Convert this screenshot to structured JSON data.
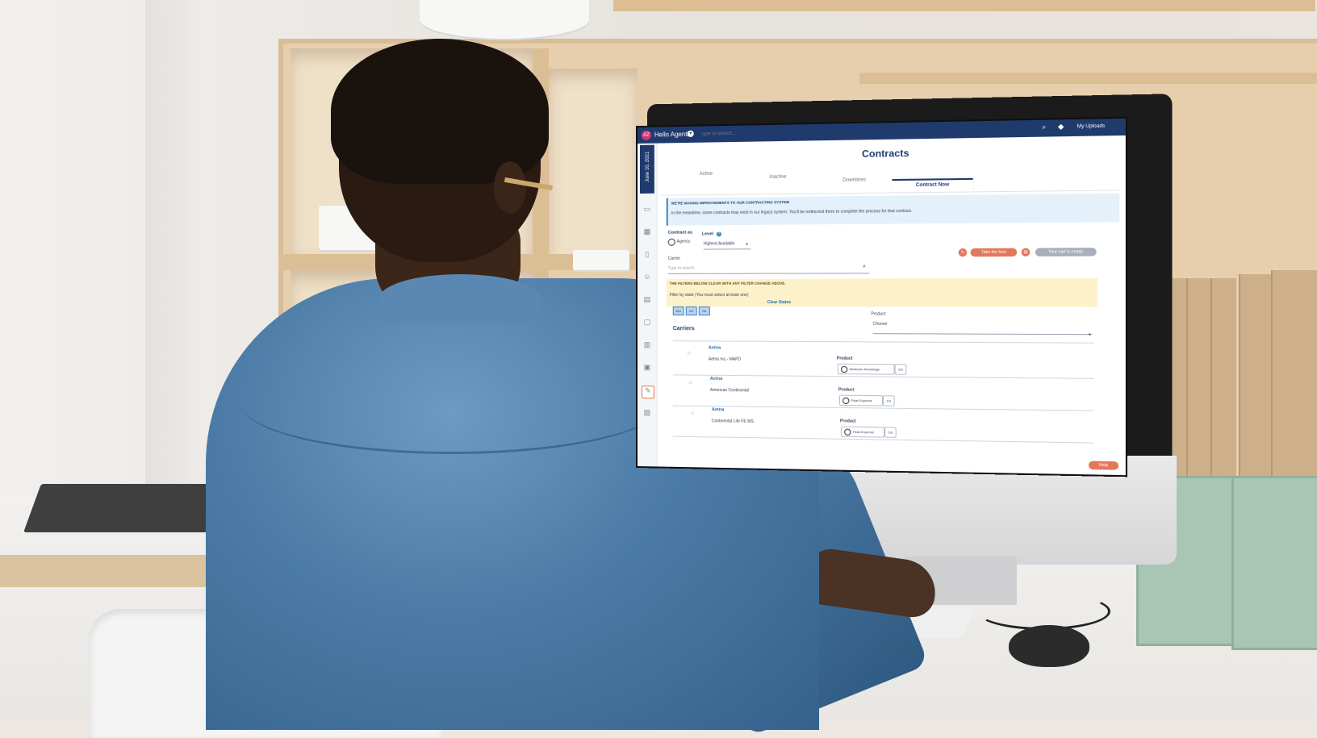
{
  "header": {
    "avatar_initials": "AZ",
    "greeting": "Hello AgentZ",
    "search_placeholder": "Type to search...",
    "uploads_label": "My Uploads"
  },
  "sidebar": {
    "date": "June 10, 2021",
    "icons": [
      "id-card-icon",
      "grid-icon",
      "document-icon",
      "people-icon",
      "inbox-icon",
      "file-icon",
      "chart-icon",
      "building-icon",
      "contract-icon",
      "copy-icon"
    ]
  },
  "page": {
    "title": "Contracts",
    "tabs": [
      "Active",
      "Inactive",
      "Downlines",
      "Contract Now"
    ],
    "active_tab": "Contract Now"
  },
  "notice": {
    "title": "WE'RE MAKING IMPROVEMENTS TO OUR CONTRACTING SYSTEM",
    "body": "In the meantime, some contracts may exist in our legacy system. You'll be redirected there to complete the process for that contract."
  },
  "form": {
    "contract_as_label": "Contract as",
    "agency_option": "Agency",
    "level_label": "Level",
    "level_value": "Highest Available",
    "carrier_label": "Carrier",
    "carrier_placeholder": "Type to search"
  },
  "actions": {
    "take_tour": "Take the tour",
    "cart": "Your cart is empty"
  },
  "filters": {
    "warning": "THE FILTERS BELOW CLEAR WITH ANY FILTER CHANGE ABOVE.",
    "state_text": "Filter by state (You must select at least one)",
    "clear_states": "Clear States",
    "states": [
      "MO",
      "NY",
      "PA"
    ],
    "product_label": "Product",
    "product_value": "Choose"
  },
  "carriers": {
    "heading": "Carriers",
    "product_heading": "Product",
    "rows": [
      {
        "name": "Aetna",
        "sub": "Aetna Inc.- MAPD",
        "product": "Medicare Advantage",
        "code": "D3"
      },
      {
        "name": "Aetna",
        "sub": "American Continental",
        "product": "Final Expense",
        "code": "D3"
      },
      {
        "name": "Aetna",
        "sub": "Continental Life FE MS",
        "product": "Final Expense",
        "code": "D3"
      }
    ]
  },
  "footer": {
    "help_label": "Help"
  },
  "colors": {
    "brand_navy": "#1f3a6d",
    "accent_orange": "#e3775b",
    "link_blue": "#2b6cb0"
  }
}
